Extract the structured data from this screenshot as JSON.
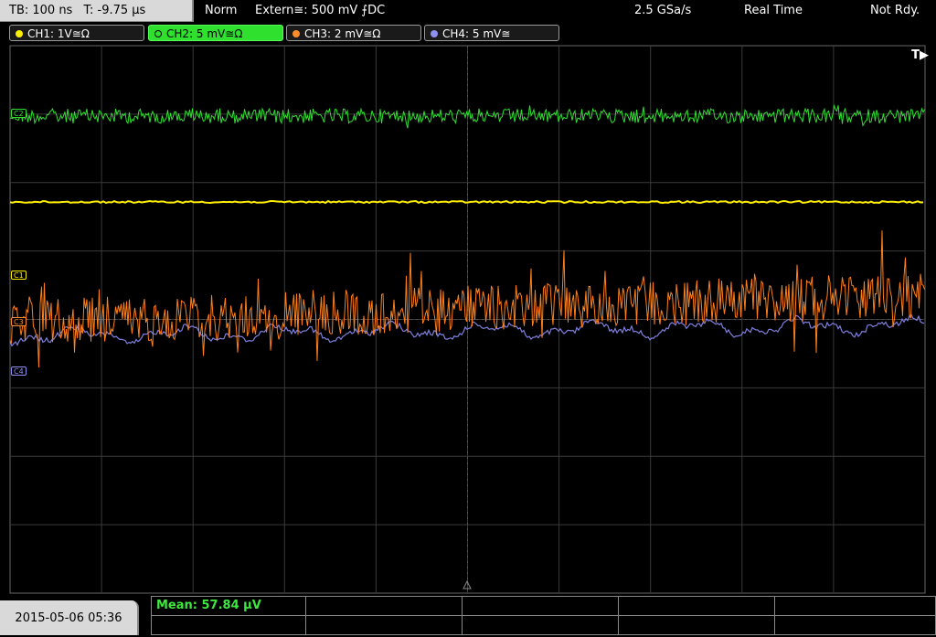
{
  "topbar": {
    "timebase": "TB: 100 ns",
    "trigger_time": "T: -9.75 µs",
    "mode": "Norm",
    "trigger_source": "Extern≅: 500 mV ⨍DC",
    "sample_rate": "2.5 GSa/s",
    "acq_mode": "Real Time",
    "status": "Not Rdy."
  },
  "channels": [
    {
      "label": "CH1: 1V≅Ω",
      "color": "#ffee00"
    },
    {
      "label": "CH2: 5 mV≅Ω",
      "color": "#2fe02f"
    },
    {
      "label": "CH3: 2 mV≅Ω",
      "color": "#ff8c2a"
    },
    {
      "label": "CH4: 5 mV≅",
      "color": "#8f8fef"
    }
  ],
  "scope": {
    "trigger_indicator": "T▶",
    "markers": {
      "c1": "C1",
      "c3": "C3",
      "c4": "C4",
      "c2": "C2"
    },
    "colors": {
      "ch1": "#ffee00",
      "ch2": "#2fe02f",
      "ch3": "#ff7f1a",
      "ch4": "#7f7fdf",
      "grid": "#3a3a3a"
    }
  },
  "bottom": {
    "datetime": "2015-05-06 05:36",
    "measurement": "Mean: 57.84 µV"
  }
}
